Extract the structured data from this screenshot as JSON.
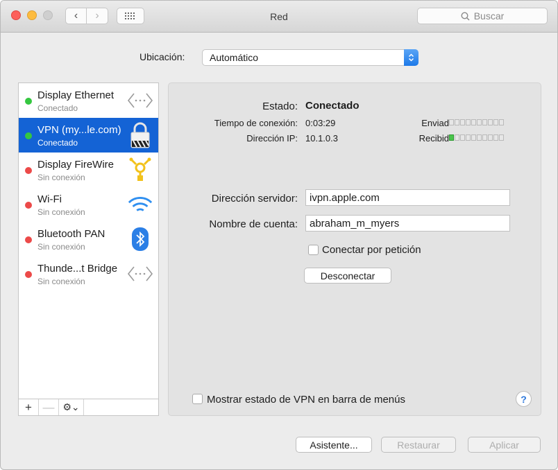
{
  "window": {
    "title": "Red",
    "search_placeholder": "Buscar"
  },
  "location": {
    "label": "Ubicación:",
    "value": "Automático"
  },
  "services": [
    {
      "name": "Display Ethernet",
      "status": "Conectado",
      "state": "green",
      "icon": "ethernet-icon"
    },
    {
      "name": "VPN (my...le.com)",
      "status": "Conectado",
      "state": "green",
      "icon": "vpn-lock-icon"
    },
    {
      "name": "Display FireWire",
      "status": "Sin conexión",
      "state": "red",
      "icon": "firewire-icon"
    },
    {
      "name": "Wi-Fi",
      "status": "Sin conexión",
      "state": "red",
      "icon": "wifi-icon"
    },
    {
      "name": "Bluetooth PAN",
      "status": "Sin conexión",
      "state": "red",
      "icon": "bluetooth-icon"
    },
    {
      "name": "Thunde...t Bridge",
      "status": "Sin conexión",
      "state": "red",
      "icon": "thunderbolt-bridge-icon"
    }
  ],
  "sidebar_tools": {
    "add": "+",
    "remove": "—",
    "gear": "⚙⌄"
  },
  "detail": {
    "estado_label": "Estado:",
    "estado_value": "Conectado",
    "tiempo_label": "Tiempo de conexión:",
    "tiempo_value": "0:03:29",
    "ip_label": "Dirección IP:",
    "ip_value": "10.1.0.3",
    "enviado_label": "Enviad",
    "recibido_label": "Recibid",
    "enviado_level": 0,
    "recibido_level": 1,
    "server_label": "Dirección servidor:",
    "server_value": "ivpn.apple.com",
    "account_label": "Nombre de cuenta:",
    "account_value": "abraham_m_myers",
    "on_demand_label": "Conectar por petición",
    "disconnect_label": "Desconectar",
    "show_vpn_label": "Mostrar estado de VPN en barra de menús",
    "help_label": "?"
  },
  "footer": {
    "assistant": "Asistente...",
    "revert": "Restaurar",
    "apply": "Aplicar"
  },
  "colors": {
    "selection": "#1463d5",
    "connected": "#35c740",
    "disconnected": "#ec4a49"
  }
}
